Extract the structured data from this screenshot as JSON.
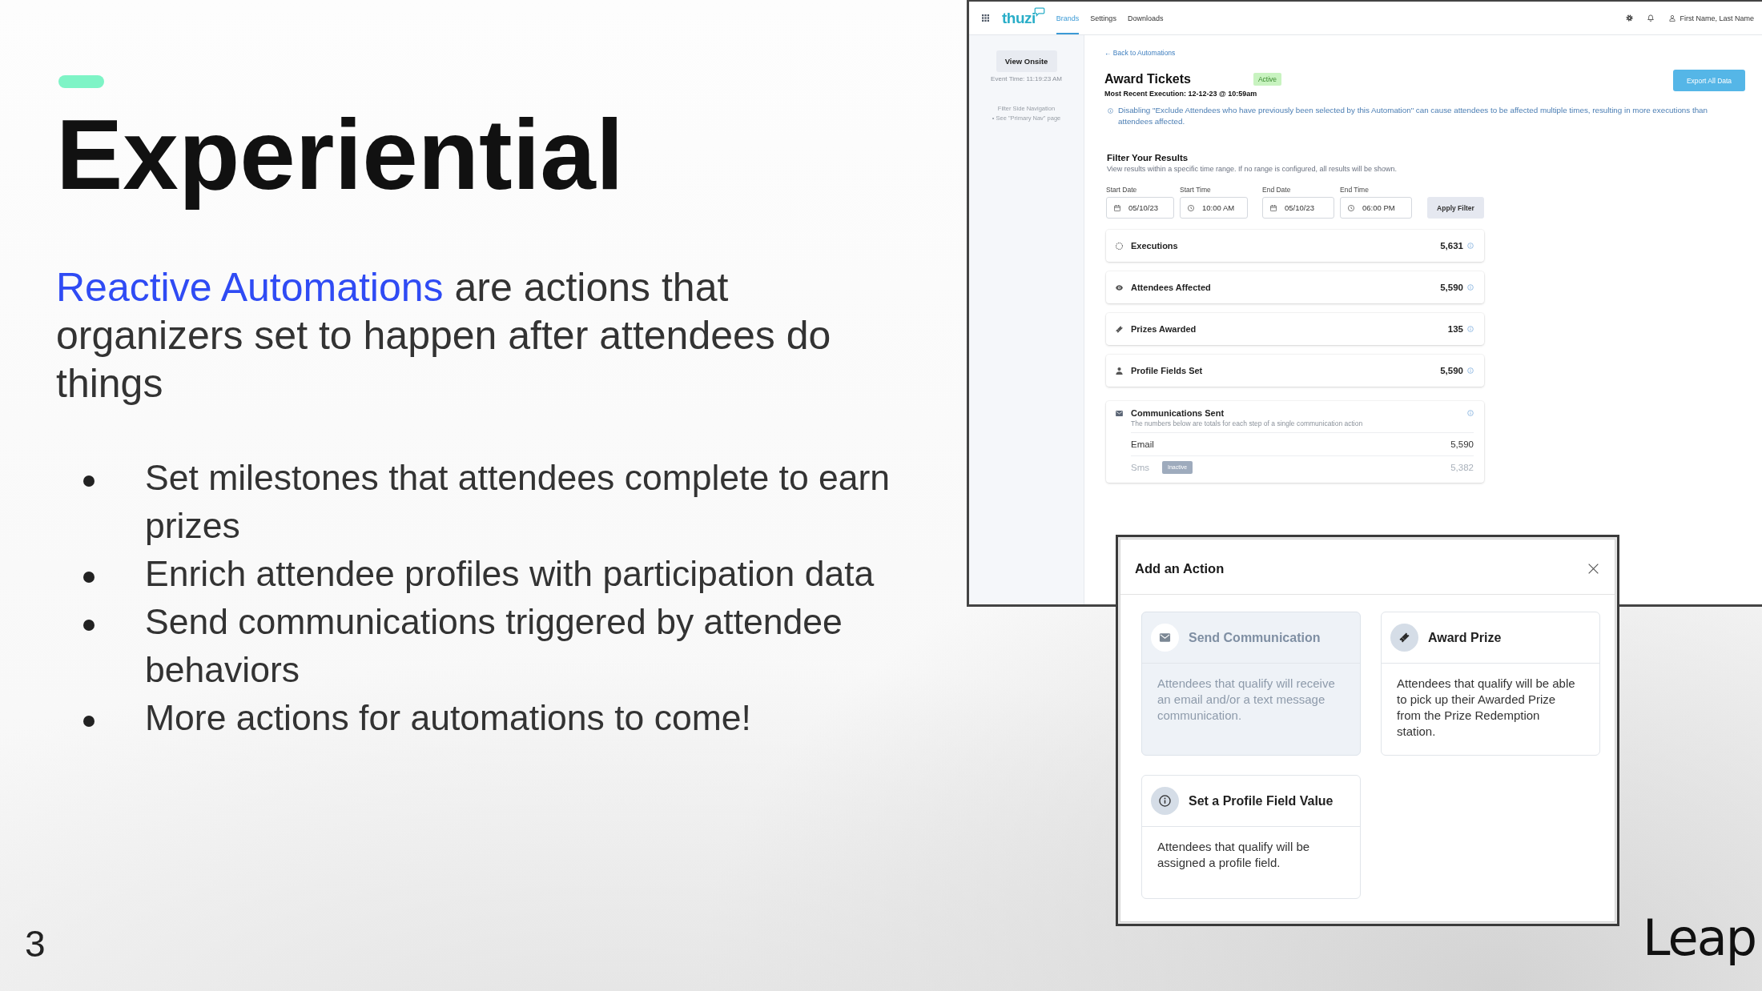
{
  "slide": {
    "title": "Experiential",
    "intro": {
      "highlight": "Reactive Automations",
      "text": "are actions that organizers set to happen after attendees do things"
    },
    "bullets": [
      "Set milestones that attendees complete to earn prizes",
      "Enrich attendee profiles with participation data",
      "Send communications triggered by attendee behaviors",
      "More actions for automations to come!"
    ],
    "page_number": "3",
    "logo": "Leap"
  },
  "app": {
    "top_nav": {
      "logo": "thuzi",
      "tabs": [
        {
          "label": "Brands",
          "selected": true
        },
        {
          "label": "Settings",
          "selected": false
        },
        {
          "label": "Downloads",
          "selected": false
        }
      ],
      "user": "First Name, Last Name"
    },
    "sidebar": {
      "button": "View Onsite",
      "event_time": "Event Time: 11:19:23 AM",
      "notes": [
        "Filter Side Navigation",
        "• See \"Primary Nav\" page"
      ]
    },
    "header": {
      "back_link": "← Back to Automations",
      "title": "Award Tickets",
      "status": "Active",
      "last_run": "Most Recent Execution: 12-12-23 @ 10:59am",
      "export_button": "Export All Data",
      "notice": "Disabling \"Exclude Attendees who have previously been selected by this Automation\" can cause attendees to be affected multiple times, resulting in more executions than attendees affected."
    },
    "filter": {
      "title": "Filter Your Results",
      "hint": "View results within a specific time range. If no range is configured, all results will be shown.",
      "fields": [
        {
          "label": "Start Date",
          "kind": "date",
          "value": "05/10/23"
        },
        {
          "label": "Start Time",
          "kind": "time",
          "value": "10:00 AM"
        },
        {
          "label": "End Date",
          "kind": "date",
          "value": "05/10/23"
        },
        {
          "label": "End Time",
          "kind": "time",
          "value": "06:00 PM"
        }
      ],
      "apply_button": "Apply Filter"
    },
    "metrics": [
      {
        "kind": "executions",
        "label": "Executions",
        "value": "5,631"
      },
      {
        "kind": "attendees",
        "label": "Attendees Affected",
        "value": "5,590"
      },
      {
        "kind": "prizes",
        "label": "Prizes Awarded",
        "value": "135"
      },
      {
        "kind": "profile",
        "label": "Profile Fields Set",
        "value": "5,590"
      }
    ],
    "communications": {
      "title": "Communications Sent",
      "subtitle": "The numbers below are totals for each step of a single communication action",
      "channels": [
        {
          "name": "Email",
          "value": "5,590",
          "inactive": false
        },
        {
          "name": "Sms",
          "value": "5,382",
          "inactive": true,
          "badge": "Inactive"
        }
      ]
    }
  },
  "modal": {
    "title": "Add an Action",
    "actions": [
      {
        "kind": "communication",
        "title": "Send Communication",
        "description": "Attendees that qualify will receive an email and/or a text message communication.",
        "disabled": true
      },
      {
        "kind": "prize",
        "title": "Award Prize",
        "description": "Attendees that qualify will be able to pick up their Awarded Prize from the Prize Redemption station.",
        "disabled": false
      },
      {
        "kind": "profile",
        "title": "Set a Profile Field Value",
        "description": "Attendees that qualify will be assigned a profile field.",
        "disabled": false
      }
    ]
  }
}
